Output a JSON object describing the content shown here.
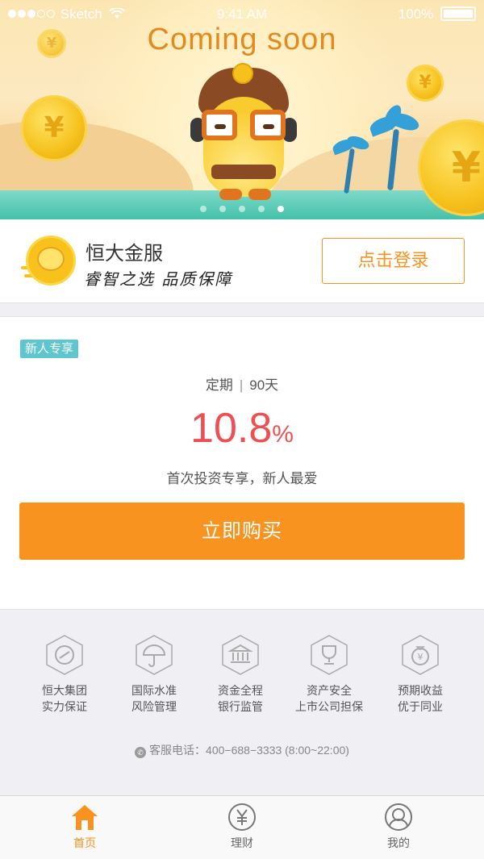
{
  "status_bar": {
    "carrier": "Sketch",
    "time": "9:41 AM",
    "battery": "100%"
  },
  "banner": {
    "title": "Coming soon",
    "slide_count": 5,
    "active_index": 4
  },
  "brand": {
    "name": "恒大金服",
    "slogan": "睿智之选 品质保障",
    "login_label": "点击登录"
  },
  "product": {
    "tag": "新人专享",
    "term_type": "定期",
    "term_separator": "|",
    "term_days": "90天",
    "rate_value": "10.8",
    "rate_unit": "%",
    "description": "首次投资专享，新人最爱",
    "buy_label": "立即购买"
  },
  "features": [
    {
      "icon": "group-shield-icon",
      "line1": "恒大集团",
      "line2": "实力保证"
    },
    {
      "icon": "umbrella-icon",
      "line1": "国际水准",
      "line2": "风险管理"
    },
    {
      "icon": "bank-icon",
      "line1": "资金全程",
      "line2": "银行监管"
    },
    {
      "icon": "trophy-icon",
      "line1": "资产安全",
      "line2": "上市公司担保"
    },
    {
      "icon": "money-bag-icon",
      "line1": "预期收益",
      "line2": "优于同业"
    }
  ],
  "hotline": {
    "text": "客服电话：400−688−3333 (8:00~22:00)"
  },
  "tabbar": {
    "items": [
      {
        "label": "首页",
        "icon": "home-icon",
        "active": true
      },
      {
        "label": "理财",
        "icon": "yuan-icon",
        "active": false
      },
      {
        "label": "我的",
        "icon": "user-icon",
        "active": false
      }
    ]
  },
  "colors": {
    "accent": "#f7931e",
    "rate": "#ee4f53",
    "tag": "#5dc6cf"
  }
}
